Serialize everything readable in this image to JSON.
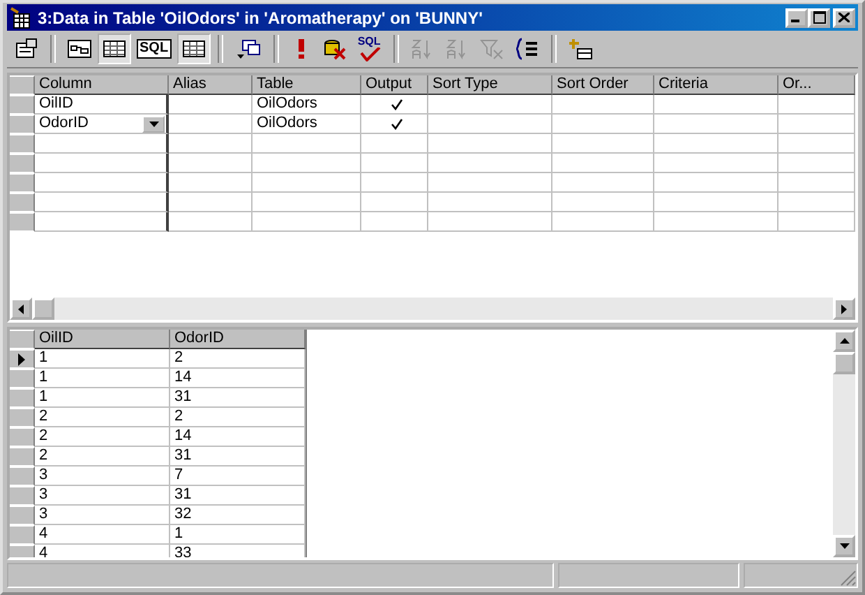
{
  "window": {
    "title": "3:Data in Table 'OilOdors' in 'Aromatherapy' on 'BUNNY'"
  },
  "toolbar": [
    {
      "kind": "properties",
      "pressed": false,
      "disabled": false
    },
    {
      "kind": "separator"
    },
    {
      "kind": "diagram",
      "pressed": false,
      "disabled": false
    },
    {
      "kind": "grid",
      "pressed": true,
      "disabled": false
    },
    {
      "kind": "sql",
      "label": "SQL",
      "pressed": false,
      "disabled": false
    },
    {
      "kind": "results",
      "pressed": true,
      "disabled": false
    },
    {
      "kind": "separator"
    },
    {
      "kind": "change-type",
      "pressed": false,
      "disabled": false
    },
    {
      "kind": "separator"
    },
    {
      "kind": "run",
      "pressed": false,
      "disabled": false
    },
    {
      "kind": "clear-results",
      "pressed": false,
      "disabled": false
    },
    {
      "kind": "verify",
      "label": "SQL",
      "pressed": false,
      "disabled": false
    },
    {
      "kind": "separator"
    },
    {
      "kind": "sort-asc",
      "pressed": false,
      "disabled": true
    },
    {
      "kind": "sort-desc",
      "pressed": false,
      "disabled": true
    },
    {
      "kind": "remove-filter",
      "pressed": false,
      "disabled": true
    },
    {
      "kind": "group-by",
      "pressed": false,
      "disabled": false
    },
    {
      "kind": "separator"
    },
    {
      "kind": "add-table",
      "pressed": false,
      "disabled": false
    }
  ],
  "criteria_grid": {
    "columns": [
      "Column",
      "Alias",
      "Table",
      "Output",
      "Sort Type",
      "Sort Order",
      "Criteria",
      "Or..."
    ],
    "rows": [
      {
        "column": "OilID",
        "table": "OilOdors",
        "output": true,
        "dropdown": false
      },
      {
        "column": "OdorID",
        "table": "OilOdors",
        "output": true,
        "dropdown": true
      }
    ]
  },
  "results": {
    "columns": [
      "OilID",
      "OdorID"
    ],
    "rows": [
      {
        "cells": [
          "1",
          "2"
        ],
        "current": true
      },
      {
        "cells": [
          "1",
          "14"
        ],
        "current": false
      },
      {
        "cells": [
          "1",
          "31"
        ],
        "current": false
      },
      {
        "cells": [
          "2",
          "2"
        ],
        "current": false
      },
      {
        "cells": [
          "2",
          "14"
        ],
        "current": false
      },
      {
        "cells": [
          "2",
          "31"
        ],
        "current": false
      },
      {
        "cells": [
          "3",
          "7"
        ],
        "current": false
      },
      {
        "cells": [
          "3",
          "31"
        ],
        "current": false
      },
      {
        "cells": [
          "3",
          "32"
        ],
        "current": false
      },
      {
        "cells": [
          "4",
          "1"
        ],
        "current": false
      },
      {
        "cells": [
          "4",
          "33"
        ],
        "current": false
      }
    ]
  }
}
